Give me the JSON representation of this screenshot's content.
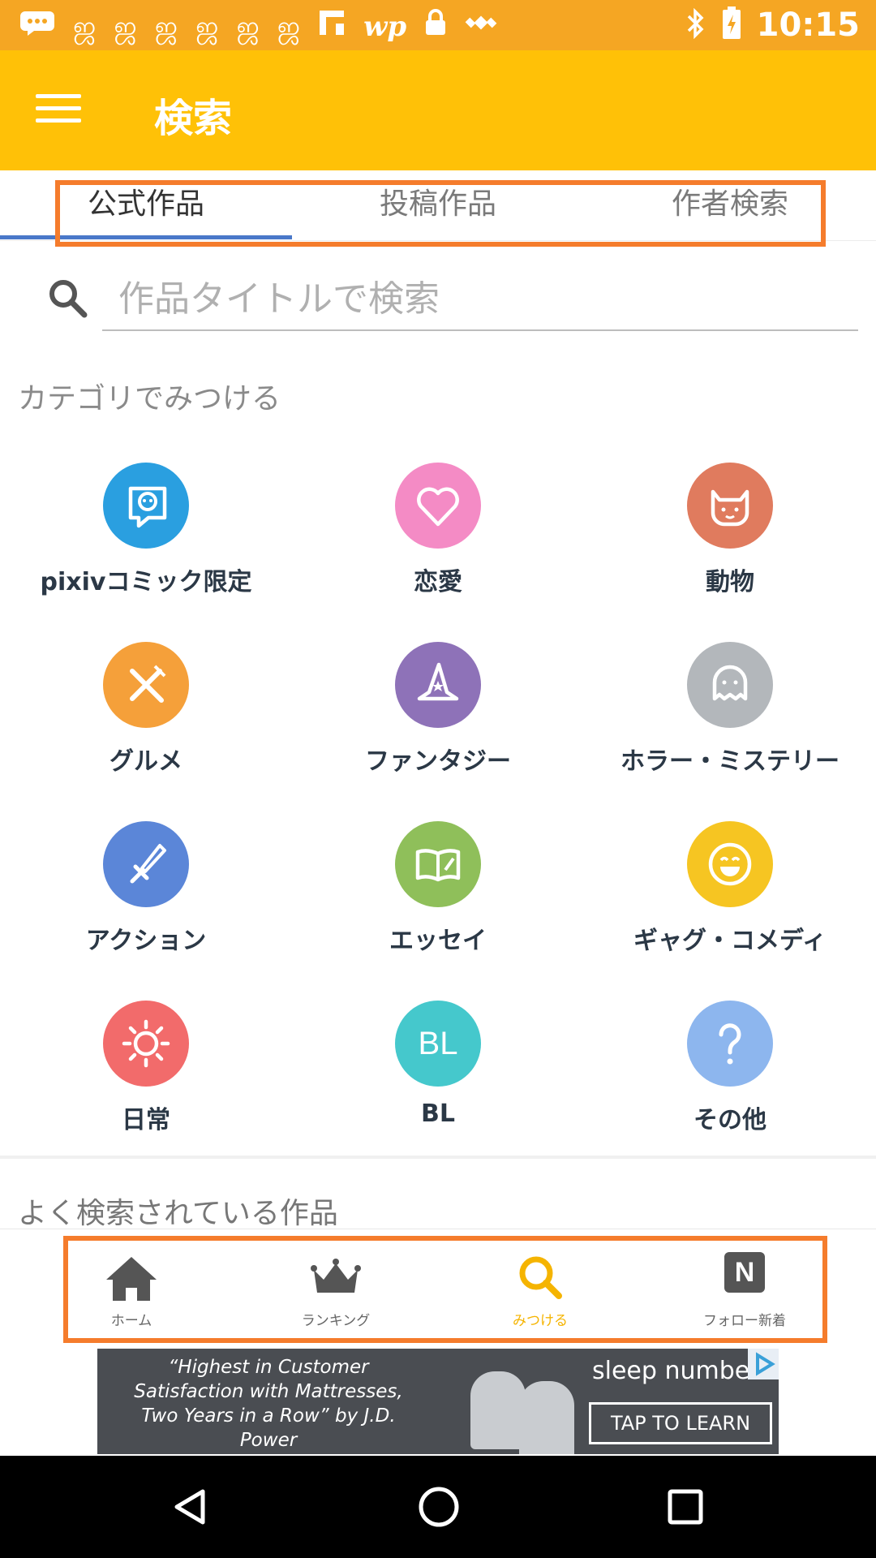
{
  "status_bar": {
    "time": "10:15",
    "left_icons": [
      "message-icon",
      "sync-icon",
      "sync-icon",
      "sync-icon",
      "sync-icon",
      "sync-icon",
      "sync-icon",
      "flipboard-icon",
      "wp-icon",
      "lock-icon",
      "fake-gps-icon"
    ],
    "wp_text": "wp",
    "right_icons": [
      "bluetooth-icon",
      "battery-charging-icon"
    ]
  },
  "app_bar": {
    "title": "検索",
    "background_color": "#FFC107"
  },
  "tabs": [
    {
      "label": "公式作品",
      "active": true
    },
    {
      "label": "投稿作品",
      "active": false
    },
    {
      "label": "作者検索",
      "active": false
    }
  ],
  "search": {
    "placeholder": "作品タイトルで検索",
    "value": ""
  },
  "category_section": {
    "title": "カテゴリでみつける",
    "items": [
      {
        "label": "pixivコミック限定",
        "icon": "pixiv-comic-icon",
        "color": "#2A9FE0"
      },
      {
        "label": "恋愛",
        "icon": "heart-icon",
        "color": "#F48BC5"
      },
      {
        "label": "動物",
        "icon": "cat-icon",
        "color": "#E07B5E"
      },
      {
        "label": "グルメ",
        "icon": "fork-knife-icon",
        "color": "#F5A03A"
      },
      {
        "label": "ファンタジー",
        "icon": "wizard-hat-icon",
        "color": "#8E72B8"
      },
      {
        "label": "ホラー・ミステリー",
        "icon": "ghost-icon",
        "color": "#B3B7BB"
      },
      {
        "label": "アクション",
        "icon": "sword-icon",
        "color": "#5B86D8"
      },
      {
        "label": "エッセイ",
        "icon": "book-icon",
        "color": "#8FBF5A"
      },
      {
        "label": "ギャグ・コメディ",
        "icon": "laughing-face-icon",
        "color": "#F6C522"
      },
      {
        "label": "日常",
        "icon": "sun-icon",
        "color": "#F26B6B"
      },
      {
        "label": "BL",
        "icon": "bl-icon",
        "icon_text": "BL",
        "color": "#45C8CC"
      },
      {
        "label": "その他",
        "icon": "question-icon",
        "color": "#8DB6EE"
      }
    ]
  },
  "popular_section": {
    "title": "よく検索されている作品"
  },
  "bottom_nav": [
    {
      "label": "ホーム",
      "icon": "home-icon",
      "active": false
    },
    {
      "label": "ランキング",
      "icon": "crown-icon",
      "active": false
    },
    {
      "label": "みつける",
      "icon": "search-icon",
      "active": true
    },
    {
      "label": "フォロー新着",
      "icon": "new-n-icon",
      "icon_text": "N",
      "active": false
    }
  ],
  "ad": {
    "quote": "“Highest in Customer Satisfaction with Mattresses, Two Years in a Row” by J.D. Power",
    "brand": "sleep number",
    "cta": "TAP TO LEARN"
  },
  "colors": {
    "accent": "#FFC107",
    "status_bar": "#F5A623",
    "tab_indicator": "#4A78C9",
    "highlight_box": "#F57C2C",
    "active_nav": "#F5B400"
  }
}
